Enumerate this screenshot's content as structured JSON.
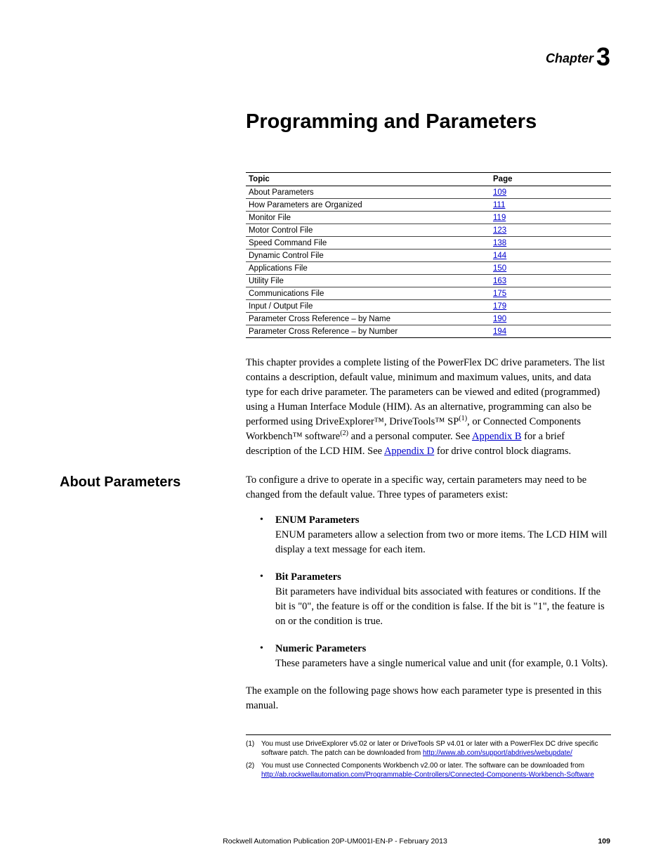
{
  "chapter": {
    "label": "Chapter",
    "number": "3"
  },
  "title": "Programming and Parameters",
  "table": {
    "headers": {
      "topic": "Topic",
      "page": "Page"
    },
    "rows": [
      {
        "topic": "About Parameters",
        "page": "109"
      },
      {
        "topic": "How Parameters are Organized",
        "page": "111"
      },
      {
        "topic": "Monitor File",
        "page": "119"
      },
      {
        "topic": "Motor Control File",
        "page": "123"
      },
      {
        "topic": "Speed Command File",
        "page": "138"
      },
      {
        "topic": "Dynamic Control File",
        "page": "144"
      },
      {
        "topic": "Applications File",
        "page": "150"
      },
      {
        "topic": "Utility File",
        "page": "163"
      },
      {
        "topic": "Communications File",
        "page": "175"
      },
      {
        "topic": "Input / Output File",
        "page": "179"
      },
      {
        "topic": "Parameter Cross Reference – by Name",
        "page": "190"
      },
      {
        "topic": "Parameter Cross Reference – by Number",
        "page": "194"
      }
    ]
  },
  "intro": {
    "p1a": "This chapter provides a complete listing of the PowerFlex DC drive parameters. The list contains a description, default value, minimum and maximum values, units, and data type for each drive parameter. The parameters can be viewed and edited (programmed) using a Human Interface Module (HIM). As an alternative, programming can also be performed using DriveExplorer™, DriveTools™ SP",
    "sup1": "(1)",
    "p1b": ", or Connected Components Workbench™ software",
    "sup2": "(2)",
    "p1c": " and a personal computer. See ",
    "linkB": "Appendix B",
    "p1d": " for a brief description of the LCD HIM. See ",
    "linkD": "Appendix D",
    "p1e": " for drive control block diagrams."
  },
  "section": {
    "heading": "About Parameters",
    "body": "To configure a drive to operate in a specific way, certain parameters may need to be changed from the default value. Three types of parameters exist:"
  },
  "params": [
    {
      "title": "ENUM Parameters",
      "body": "ENUM parameters allow a selection from two or more items. The LCD HIM will display a text message for each item."
    },
    {
      "title": "Bit Parameters",
      "body": "Bit parameters have individual bits associated with features or conditions. If the bit is \"0\", the feature is off or the condition is false. If the bit is \"1\", the feature is on or the condition is true."
    },
    {
      "title": "Numeric Parameters",
      "body": "These parameters have a single numerical value and unit (for example, 0.1 Volts)."
    }
  ],
  "example": "The example on the following page shows how each parameter type is presented in this manual.",
  "footnotes": [
    {
      "num": "(1)",
      "pre": "You must use DriveExplorer v5.02 or later or DriveTools SP v4.01 or later with a PowerFlex DC drive specific software patch. The patch can be downloaded from ",
      "link": "http://www.ab.com/support/abdrives/webupdate/",
      "post": ""
    },
    {
      "num": "(2)",
      "pre": "You must use Connected Components Workbench v2.00 or later. The software can be downloaded from ",
      "link": "http://ab.rockwellautomation.com/Programmable-Controllers/Connected-Components-Workbench-Software",
      "post": ""
    }
  ],
  "footer": {
    "pub": "Rockwell Automation Publication 20P-UM001I-EN-P - February 2013",
    "pagenum": "109"
  }
}
